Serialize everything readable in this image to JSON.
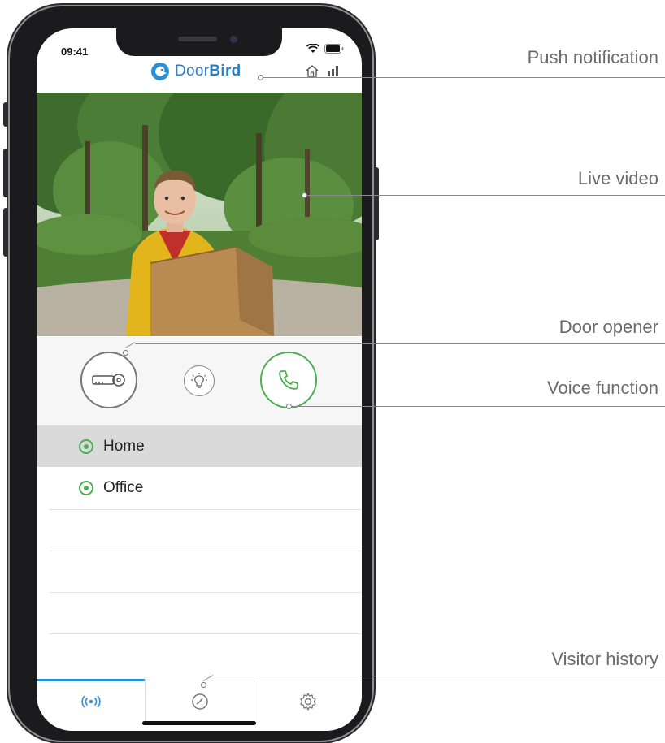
{
  "status_bar": {
    "time": "09:41"
  },
  "app": {
    "brand_prefix": "Door",
    "brand_suffix": "Bird",
    "brand_color": "#2b7fc6",
    "header_icons": [
      "home-icon",
      "signal-bars-icon"
    ]
  },
  "video": {
    "description_icon": "live-video-feed"
  },
  "controls": {
    "door_opener_icon": "key-icon",
    "light_icon": "light-bulb-icon",
    "voice_icon": "phone-icon",
    "accent_color": "#4caf50"
  },
  "devices": [
    {
      "label": "Home",
      "selected": true
    },
    {
      "label": "Office",
      "selected": false
    }
  ],
  "tabs": [
    {
      "name": "live",
      "icon": "broadcast-icon",
      "active": true
    },
    {
      "name": "history",
      "icon": "clock-icon",
      "active": false
    },
    {
      "name": "settings",
      "icon": "gear-icon",
      "active": false
    }
  ],
  "callouts": {
    "push_notification": "Push notification",
    "live_video": "Live video",
    "door_opener": "Door opener",
    "voice_function": "Voice function",
    "visitor_history": "Visitor history"
  }
}
